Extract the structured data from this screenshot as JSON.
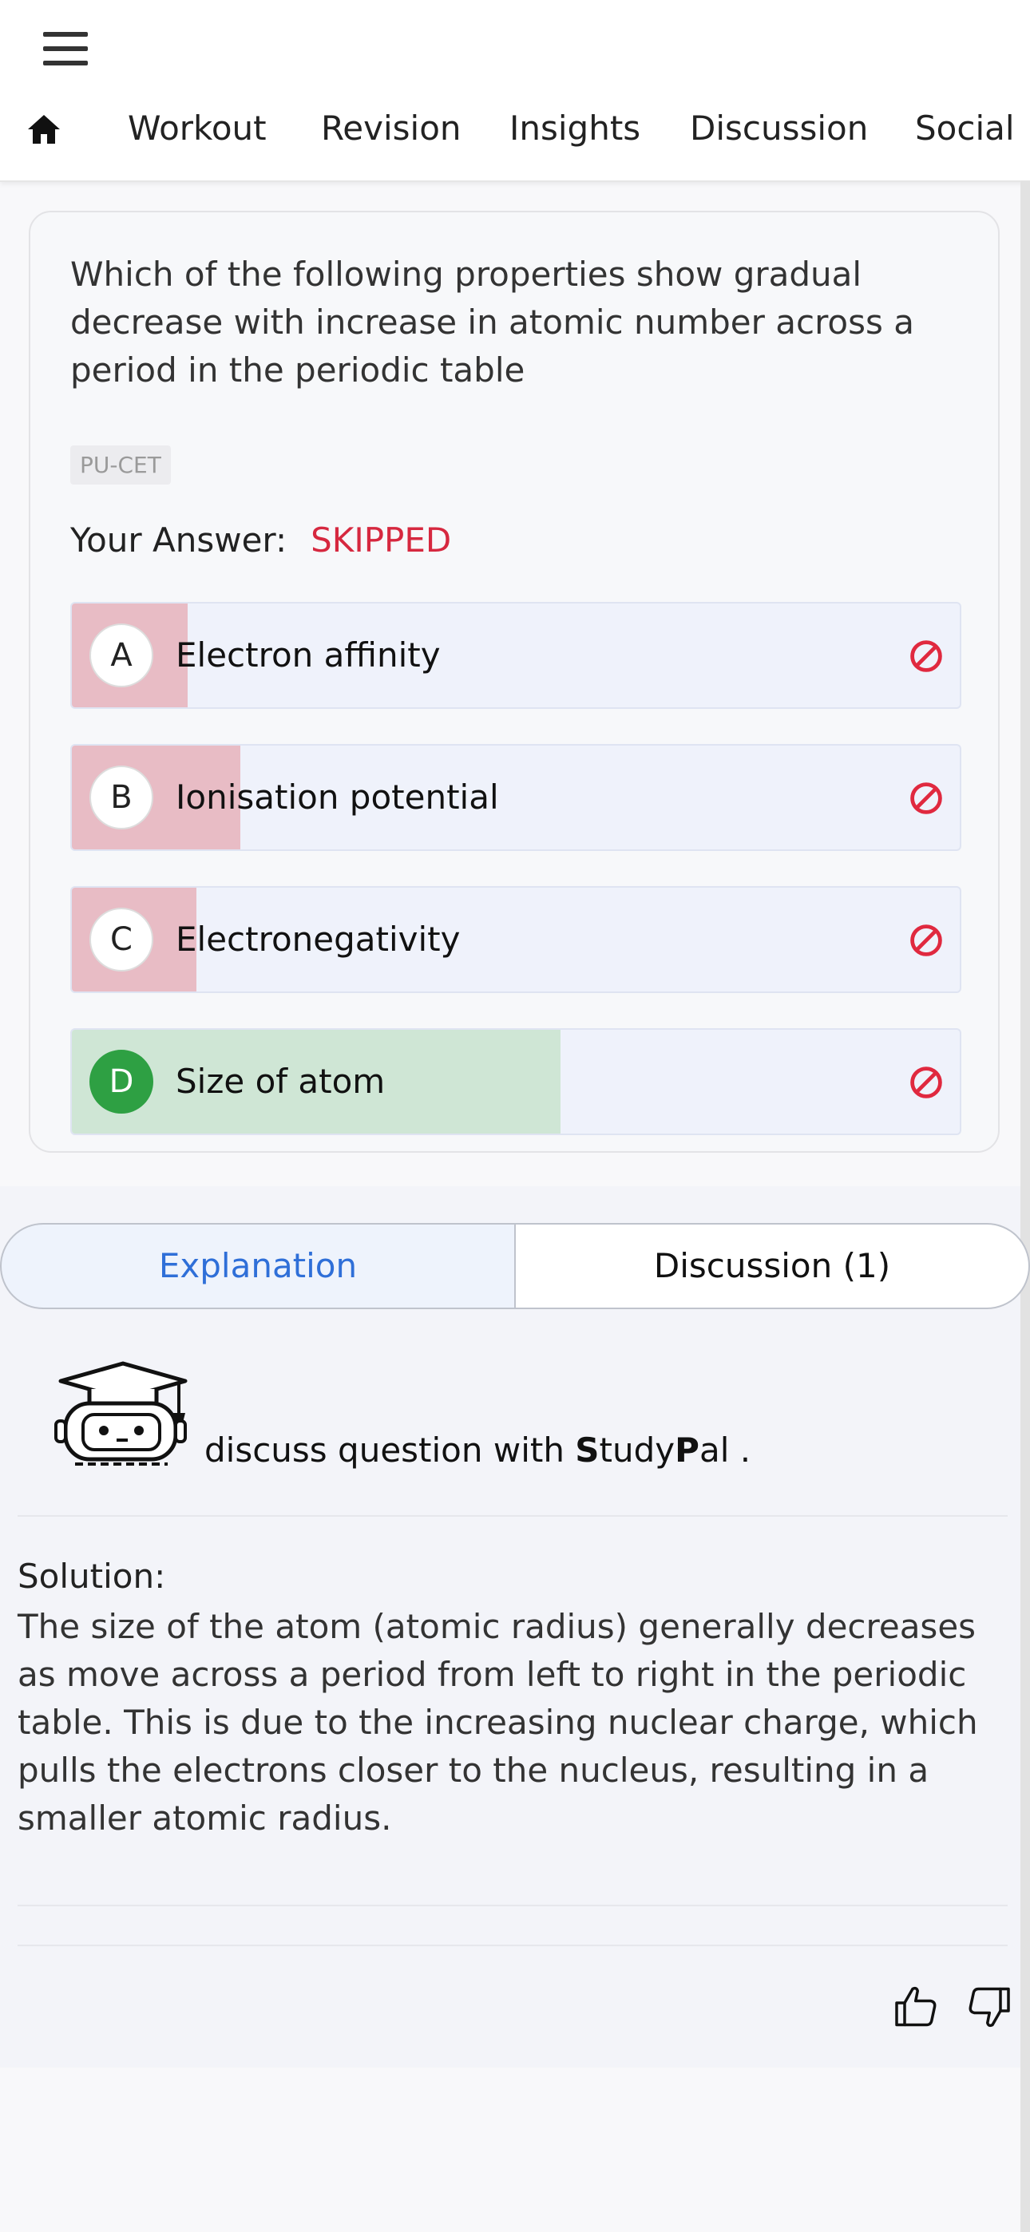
{
  "nav": {
    "items": [
      "Workout",
      "Revision",
      "Insights",
      "Discussion",
      "Social"
    ]
  },
  "question": {
    "text": "Which of the following properties show gradual decrease with increase in atomic number across a period in the periodic table",
    "tag": "PU-CET",
    "your_answer_label": "Your Answer:",
    "your_answer_value": "SKIPPED"
  },
  "options": [
    {
      "letter": "A",
      "text": "Electron affinity",
      "response_share": 0.13,
      "correct": false
    },
    {
      "letter": "B",
      "text": "Ionisation potential",
      "response_share": 0.19,
      "correct": false
    },
    {
      "letter": "C",
      "text": "Electronegativity",
      "response_share": 0.14,
      "correct": false
    },
    {
      "letter": "D",
      "text": "Size of atom",
      "response_share": 0.55,
      "correct": true
    }
  ],
  "tabs": {
    "explanation": "Explanation",
    "discussion": "Discussion (1)"
  },
  "studypal": {
    "prefix": "discuss question with ",
    "s": "S",
    "tudy": "tudy",
    "p": "P",
    "al": "al ."
  },
  "solution": {
    "heading": "Solution:",
    "text": "The size of the atom (atomic radius) generally decreases as move across a period from left to right in the periodic table. This is due to the increasing nuclear charge, which pulls the electrons closer to the nucleus, resulting in a smaller atomic radius."
  },
  "colors": {
    "accent": "#2f6fd8",
    "skipped": "#d6283f",
    "wrong_fill": "#e8bcc5",
    "correct_fill": "#cfe6d5",
    "correct_bubble": "#2ea043"
  }
}
